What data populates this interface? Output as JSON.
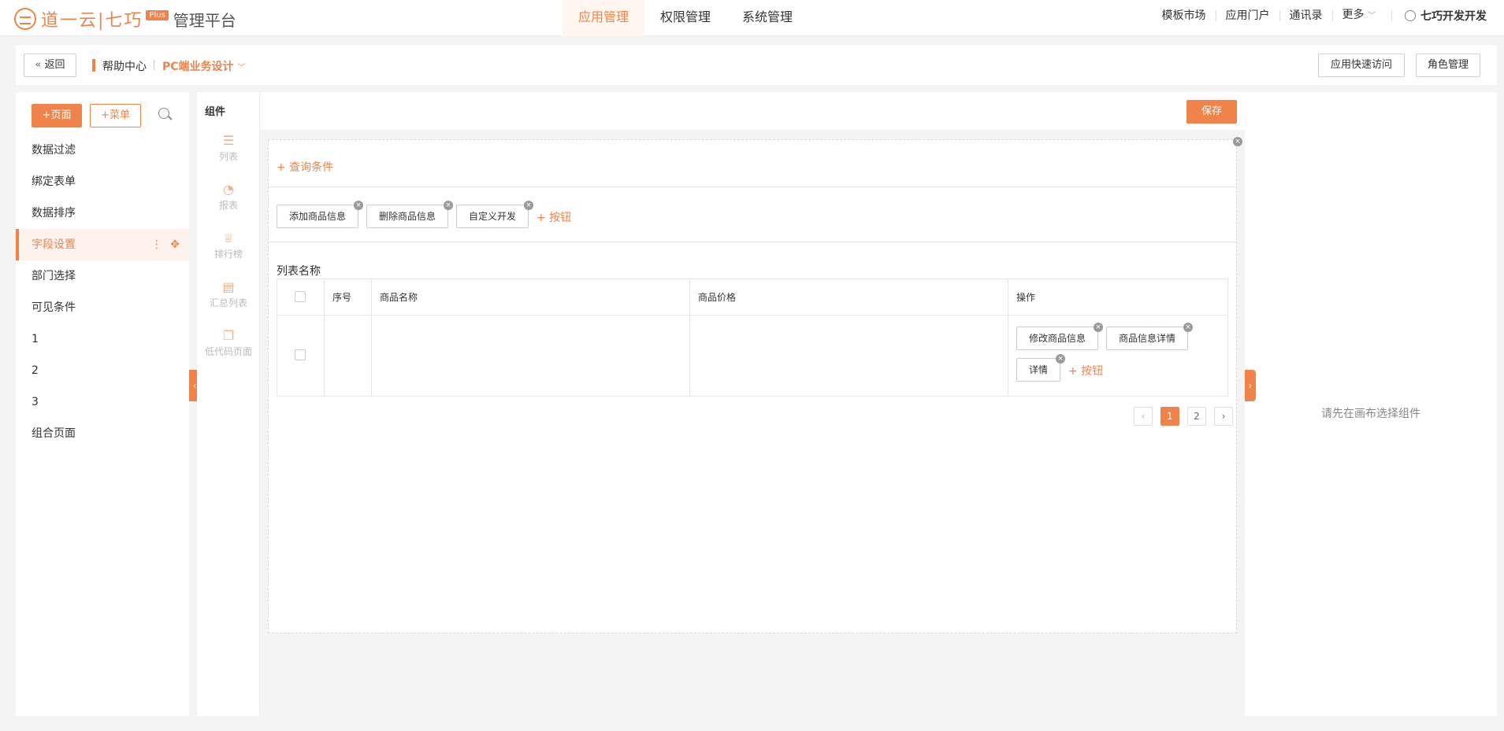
{
  "header": {
    "logo_text": "道一云|七巧",
    "logo_badge": "Plus",
    "platform_title": "管理平台",
    "nav": [
      {
        "label": "应用管理",
        "active": true
      },
      {
        "label": "权限管理",
        "active": false
      },
      {
        "label": "系统管理",
        "active": false
      }
    ],
    "links": [
      "模板市场",
      "应用门户",
      "通讯录",
      "更多"
    ],
    "user_name": "七巧开发开发"
  },
  "breadcrumb": {
    "back_label": "返回",
    "help_center": "帮助中心",
    "design_mode": "PC端业务设计",
    "quick_access_label": "应用快速访问",
    "role_manage_label": "角色管理"
  },
  "sidebar": {
    "add_page_label": "+页面",
    "add_menu_label": "+菜单",
    "items": [
      {
        "label": "数据过滤"
      },
      {
        "label": "绑定表单"
      },
      {
        "label": "数据排序"
      },
      {
        "label": "字段设置",
        "active": true
      },
      {
        "label": "部门选择"
      },
      {
        "label": "可见条件"
      },
      {
        "label": "1"
      },
      {
        "label": "2"
      },
      {
        "label": "3"
      },
      {
        "label": "组合页面"
      }
    ]
  },
  "palette": {
    "title": "组件",
    "items": [
      {
        "label": "列表",
        "icon": "list-icon"
      },
      {
        "label": "报表",
        "icon": "pie-chart-icon"
      },
      {
        "label": "排行榜",
        "icon": "trophy-icon"
      },
      {
        "label": "汇总列表",
        "icon": "summary-list-icon"
      },
      {
        "label": "低代码页面",
        "icon": "pages-icon"
      }
    ]
  },
  "canvas": {
    "save_label": "保存",
    "add_query_label": "+ 查询条件",
    "toolbar_buttons": [
      "添加商品信息",
      "删除商品信息",
      "自定义开发"
    ],
    "add_button_label": "+ 按钮",
    "list_title": "列表名称",
    "table": {
      "columns": [
        "序号",
        "商品名称",
        "商品价格",
        "操作"
      ],
      "row_actions": [
        "修改商品信息",
        "商品信息详情",
        "详情"
      ],
      "add_action_label": "+ 按钮"
    },
    "pagination": {
      "pages": [
        "1",
        "2"
      ],
      "current": "1"
    }
  },
  "right_panel": {
    "hint": "请先在画布选择组件"
  },
  "colors": {
    "accent": "#f0834a"
  }
}
